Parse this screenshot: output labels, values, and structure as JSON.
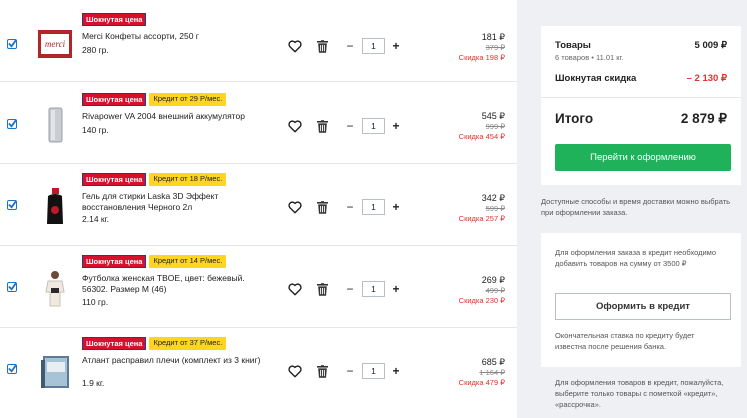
{
  "items": [
    {
      "badges": {
        "shock": "Шокнутая цена",
        "credit": ""
      },
      "name": "Merci Конфеты ассорти, 250 г",
      "weight": "280 гр.",
      "qty": "1",
      "price": "181 ₽",
      "old_price": "379 ₽",
      "discount": "Скидка 198 ₽",
      "image": "merci-candy-box"
    },
    {
      "badges": {
        "shock": "Шокнутая цена",
        "credit": "Кредит от 29 Р/мес."
      },
      "name": "Rivapower VA 2004 внешний аккумулятор",
      "weight": "140 гр.",
      "qty": "1",
      "price": "545 ₽",
      "old_price": "999 ₽",
      "discount": "Скидка 454 ₽",
      "image": "power-bank"
    },
    {
      "badges": {
        "shock": "Шокнутая цена",
        "credit": "Кредит от 18 Р/мес."
      },
      "name": "Гель для стирки Laska 3D Эффект восстановления Черного 2л",
      "weight": "2.14 кг.",
      "qty": "1",
      "price": "342 ₽",
      "old_price": "599 ₽",
      "discount": "Скидка 257 ₽",
      "image": "detergent-bottle"
    },
    {
      "badges": {
        "shock": "Шокнутая цена",
        "credit": "Кредит от 14 Р/мес."
      },
      "name": "Футболка женская TBOE, цвет: бежевый. 56302. Размер M (46)",
      "weight": "110 гр.",
      "qty": "1",
      "price": "269 ₽",
      "old_price": "499 ₽",
      "discount": "Скидка 230 ₽",
      "image": "tshirt"
    },
    {
      "badges": {
        "shock": "Шокнутая цена",
        "credit": "Кредит от 37 Р/мес."
      },
      "name": "Атлант расправил плечи (комплект из 3 книг)",
      "weight": "1.9 кг.",
      "qty": "1",
      "price": "685 ₽",
      "old_price": "1 164 ₽",
      "discount": "Скидка 479 ₽",
      "image": "book-set"
    }
  ],
  "summary": {
    "goods_label": "Товары",
    "goods_value": "5 009 ₽",
    "goods_sub": "6 товаров • 11.01 кг.",
    "discount_label": "Шокнутая скидка",
    "discount_value": "– 2 130 ₽",
    "total_label": "Итого",
    "total_value": "2 879 ₽",
    "checkout_label": "Перейти к оформлению"
  },
  "delivery_note": "Доступные способы и время доставки можно выбрать при оформлении заказа.",
  "credit": {
    "note": "Для оформления заказа в кредит необходимо добавить товаров на сумму от 3500 ₽",
    "button_label": "Оформить в кредит",
    "note2": "Окончательная ставка по кредиту будет известна после решения банка.",
    "note3": "Для оформления товаров в кредит, пожалуйста, выберите только товары с пометкой «кредит», «рассрочка»."
  },
  "colors": {
    "accent_green": "#1fb25a",
    "discount_red": "#e5302d",
    "checkbox_blue": "#1a73c9",
    "badge_red": "#d6112e",
    "badge_yellow": "#ffd61f"
  },
  "icons": [
    "checkbox-icon",
    "heart-icon",
    "trash-icon",
    "minus-icon",
    "plus-icon"
  ]
}
